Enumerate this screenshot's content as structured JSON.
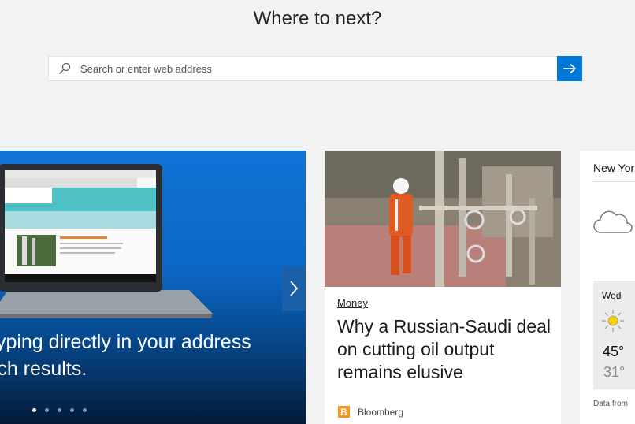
{
  "header": {
    "title": "Where to next?"
  },
  "search": {
    "placeholder": "Search or enter web address"
  },
  "hero": {
    "line1": "typing directly in your address",
    "line2": "rch results.",
    "slide_count": 5,
    "active_slide": 1
  },
  "news": {
    "category": "Money",
    "title": "Why a Russian-Saudi deal on cutting oil output remains elusive",
    "source_logo": "B",
    "source": "Bloomberg"
  },
  "weather": {
    "city": "New Yor",
    "current_icon": "cloud-icon",
    "forecast": {
      "day": "Wed",
      "icon": "sun-icon",
      "high": "45°",
      "low": "31°"
    },
    "attribution": "Data from"
  },
  "colors": {
    "accent": "#0078d7",
    "hero_top": "#1173d6",
    "hero_bottom": "#031b38",
    "source_logo": "#f7941d"
  }
}
